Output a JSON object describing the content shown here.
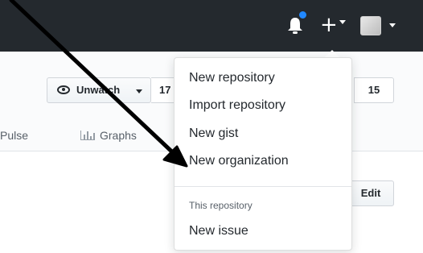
{
  "header": {
    "notifications_icon": "bell-icon",
    "create_icon": "plus-icon",
    "create_label": "+",
    "avatar_icon": "user-avatar"
  },
  "repo": {
    "unwatch_label": "Unwatch",
    "watch_count": "17",
    "fork_count": "15",
    "edit_label": "Edit"
  },
  "nav": {
    "pulse_label": "Pulse",
    "graphs_label": "Graphs"
  },
  "dropdown": {
    "items": [
      {
        "label": "New repository"
      },
      {
        "label": "Import repository"
      },
      {
        "label": "New gist"
      },
      {
        "label": "New organization"
      }
    ],
    "section_header": "This repository",
    "section_items": [
      {
        "label": "New issue"
      }
    ]
  },
  "colors": {
    "header_bg": "#24292e",
    "notification_dot": "#2188ff",
    "annotation_arrow": "#000000"
  }
}
